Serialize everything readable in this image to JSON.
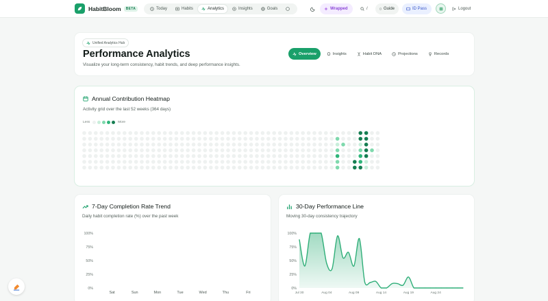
{
  "app": {
    "name": "HabitBloom",
    "badge": "BETA",
    "accent": "#1aa06a"
  },
  "nav": {
    "items": [
      {
        "label": "Today",
        "icon": "clock-icon"
      },
      {
        "label": "Habits",
        "icon": "list-icon"
      },
      {
        "label": "Analytics",
        "icon": "activity-icon",
        "active": true
      },
      {
        "label": "Insights",
        "icon": "lightbulb-icon"
      },
      {
        "label": "Goals",
        "icon": "target-icon"
      }
    ],
    "wrapped_label": "Wrapped",
    "search_shortcut": "/",
    "guide_label": "Guide",
    "idpass_label": "ID Pass",
    "logout_label": "Logout"
  },
  "header": {
    "badge": "Unified Analytics Hub",
    "title": "Performance Analytics",
    "subtitle": "Visualize your long-term consistency, habit trends, and deep performance insights.",
    "tabs": [
      {
        "label": "Overview",
        "icon": "activity-icon",
        "active": true
      },
      {
        "label": "Insights",
        "icon": "lightbulb-icon"
      },
      {
        "label": "Habit DNA",
        "icon": "dna-icon"
      },
      {
        "label": "Projections",
        "icon": "clock-icon"
      },
      {
        "label": "Records",
        "icon": "trophy-icon"
      }
    ]
  },
  "heatmap": {
    "title": "Annual Contribution Heatmap",
    "subtitle": "Activity grid over the last 52 weeks (364 days)",
    "legend_less": "Less",
    "legend_more": "More",
    "levels": [
      "#eef1f0",
      "#c9eedb",
      "#7fd9ad",
      "#2fb57a",
      "#167e52"
    ],
    "weeks": 52,
    "active_weeks": {
      "44": [
        0,
        2,
        1,
        2,
        3,
        2,
        2
      ],
      "45": [
        0,
        0,
        2,
        0,
        0,
        0,
        0
      ],
      "47": [
        0,
        0,
        0,
        0,
        0,
        4,
        4
      ],
      "48": [
        4,
        4,
        1,
        2,
        3,
        3,
        4
      ],
      "49": [
        4,
        4,
        4,
        4,
        4,
        1,
        1
      ],
      "50": [
        0,
        0,
        0,
        2,
        0,
        0,
        0
      ]
    }
  },
  "trend": {
    "title": "7-Day Completion Rate Trend",
    "subtitle": "Daily habit completion rate (%) over the past week",
    "chart_data": {
      "type": "bar",
      "categories": [
        "Sat",
        "Sun",
        "Mon",
        "Tue",
        "Wed",
        "Thu",
        "Fri"
      ],
      "values": [
        0,
        0,
        0,
        0,
        0,
        0,
        0
      ],
      "yticks": [
        "0%",
        "25%",
        "50%",
        "75%",
        "100%"
      ],
      "ylim": [
        0,
        100
      ]
    }
  },
  "performance": {
    "title": "30-Day Performance Line",
    "subtitle": "Moving 30-day consistency trajectory",
    "chart_data": {
      "type": "area",
      "x": [
        "Jul 30",
        "Jul 31",
        "Aug 01",
        "Aug 02",
        "Aug 03",
        "Aug 04",
        "Aug 05",
        "Aug 06",
        "Aug 07",
        "Aug 08",
        "Aug 09",
        "Aug 10",
        "Aug 11",
        "Aug 12",
        "Aug 13",
        "Aug 14",
        "Aug 15",
        "Aug 16",
        "Aug 17",
        "Aug 18",
        "Aug 19",
        "Aug 20",
        "Aug 21",
        "Aug 22",
        "Aug 23",
        "Aug 24",
        "Aug 25",
        "Aug 26",
        "Aug 27",
        "Aug 28",
        "Aug 29"
      ],
      "values": [
        88,
        40,
        100,
        100,
        100,
        45,
        35,
        95,
        55,
        65,
        40,
        90,
        10,
        10,
        12,
        0,
        0,
        8,
        8,
        5,
        20,
        0,
        0,
        0,
        0,
        0,
        0,
        0,
        0,
        0,
        0
      ],
      "xticks": [
        "Jul 30",
        "Aug 04",
        "Aug 09",
        "Aug 14",
        "Aug 19",
        "Aug 24"
      ],
      "yticks": [
        "0%",
        "25%",
        "50%",
        "75%",
        "100%"
      ],
      "ylim": [
        0,
        100
      ],
      "color": "#2fae78"
    }
  }
}
